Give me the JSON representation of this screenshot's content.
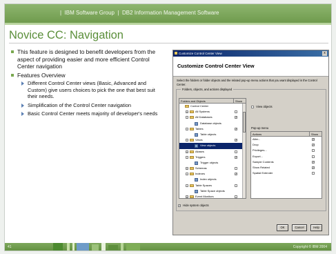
{
  "header": {
    "text": "|  IBM Software Group  |  DB2 Information Management Software"
  },
  "slide": {
    "title": "Novice CC: Navigation",
    "bullets": [
      {
        "text": "This feature is designed to benefit developers from the aspect of providing easier and more efficient Control Center navigation",
        "sub": []
      },
      {
        "text": "Features Overview",
        "sub": [
          "Different Control Center views (Basic, Advanced and Custom) give users choices to pick the one that best suit their needs.",
          "Simplification of the Control Center navigation",
          "Basic Control Center meets majority of developer's needs"
        ]
      }
    ]
  },
  "dialog": {
    "window_title": "Customize Control Center View",
    "close_glyph": "x",
    "banner_title": "Customize Control Center View",
    "instruction": "Select the folders or folder objects and the related pop-up menu actions that you want displayed in the Control Center.",
    "group_label": "Folders, objects, and actions displayed",
    "tree_headers": [
      "Folders and Objects",
      "Show"
    ],
    "tree_rows": [
      {
        "label": "Control Center",
        "indent": 0,
        "kind": "folder",
        "expander": "",
        "checked": ""
      },
      {
        "label": "All Systems",
        "indent": 1,
        "kind": "folder",
        "expander": "+",
        "checked": ""
      },
      {
        "label": "All Databases",
        "indent": 1,
        "kind": "folder",
        "expander": "-",
        "checked": "✓"
      },
      {
        "label": "Database objects",
        "indent": 2,
        "kind": "object",
        "expander": "",
        "checked": ""
      },
      {
        "label": "Tables",
        "indent": 1,
        "kind": "folder",
        "expander": "-",
        "checked": "✓"
      },
      {
        "label": "Table objects",
        "indent": 2,
        "kind": "object",
        "expander": "",
        "checked": ""
      },
      {
        "label": "Views",
        "indent": 1,
        "kind": "folder",
        "expander": "-",
        "checked": "✓"
      },
      {
        "label": "View objects",
        "indent": 2,
        "kind": "object",
        "expander": "",
        "checked": "",
        "selected": true
      },
      {
        "label": "Aliases",
        "indent": 1,
        "kind": "folder",
        "expander": "+",
        "checked": ""
      },
      {
        "label": "Triggers",
        "indent": 1,
        "kind": "folder",
        "expander": "-",
        "checked": "✓"
      },
      {
        "label": "Trigger objects",
        "indent": 2,
        "kind": "object",
        "expander": "",
        "checked": ""
      },
      {
        "label": "Schemas",
        "indent": 1,
        "kind": "folder",
        "expander": "+",
        "checked": ""
      },
      {
        "label": "Indexes",
        "indent": 1,
        "kind": "folder",
        "expander": "-",
        "checked": "✓"
      },
      {
        "label": "Index objects",
        "indent": 2,
        "kind": "object",
        "expander": "",
        "checked": ""
      },
      {
        "label": "Table Spaces",
        "indent": 1,
        "kind": "folder",
        "expander": "-",
        "checked": ""
      },
      {
        "label": "Table Space objects",
        "indent": 2,
        "kind": "object",
        "expander": "",
        "checked": ""
      },
      {
        "label": "Event Monitors",
        "indent": 1,
        "kind": "folder",
        "expander": "+",
        "checked": ""
      }
    ],
    "view_objects_label": "View objects",
    "popup_label": "Pop-up menu",
    "popup_headers": [
      "Actions",
      "Show"
    ],
    "popup_rows": [
      {
        "label": "Alter...",
        "checked": "✓"
      },
      {
        "label": "Drop",
        "checked": "✓"
      },
      {
        "label": "Privileges...",
        "checked": ""
      },
      {
        "label": "Export...",
        "checked": ""
      },
      {
        "label": "Sample Contents",
        "checked": "✓"
      },
      {
        "label": "Show Related",
        "checked": "✓"
      },
      {
        "label": "Spatial Extender",
        "checked": ""
      }
    ],
    "hide_system_label": "Hide system objects",
    "hide_system_checked": "✓",
    "buttons": [
      "OK",
      "Cancel",
      "Help"
    ]
  },
  "footer": {
    "page_number": "41",
    "copyright": "Copyright © IBM 2004"
  },
  "colors": {
    "header_green": "#7aa556",
    "title_green": "#5a8e39",
    "bullet_green": "#79a84f",
    "selection_blue": "#0a246a"
  }
}
